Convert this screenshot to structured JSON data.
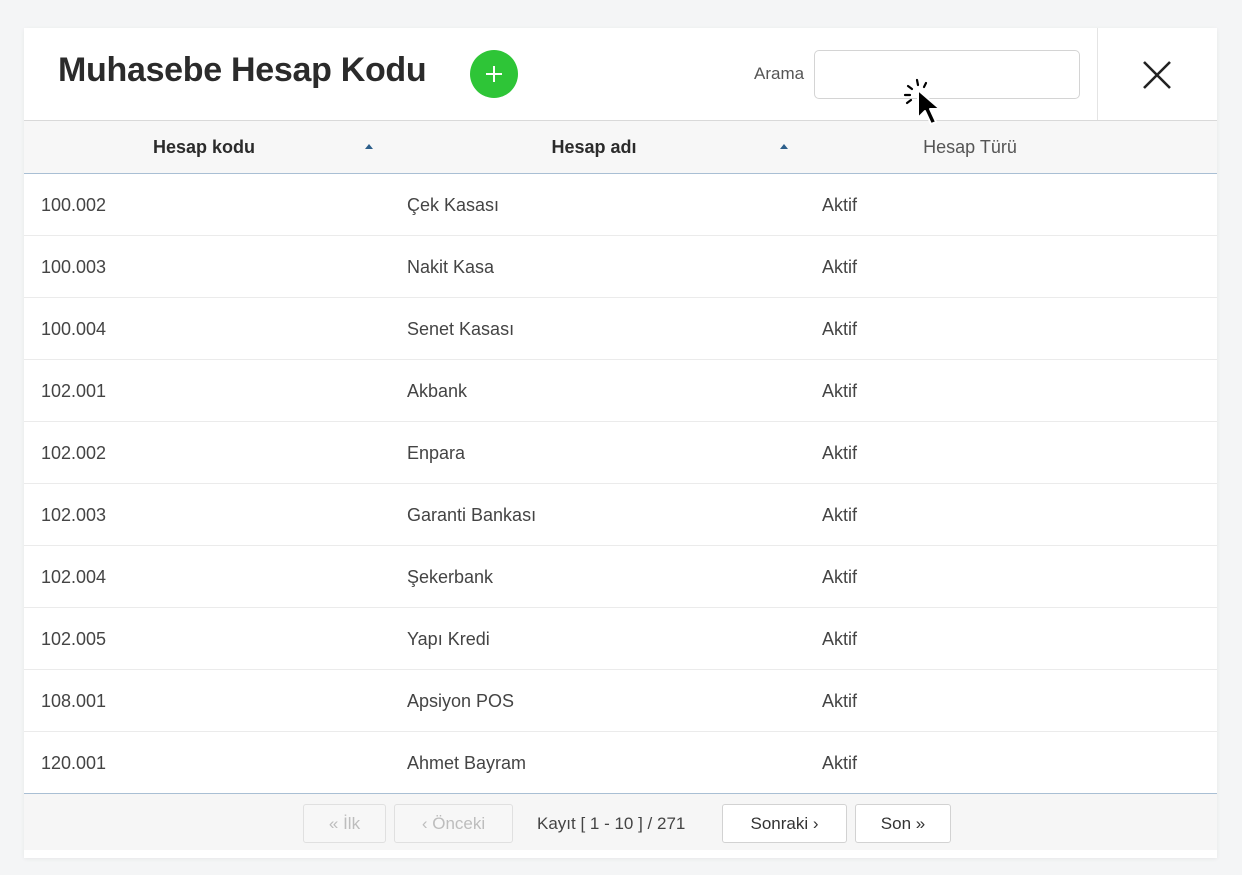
{
  "dialog": {
    "title": "Muhasebe Hesap Kodu",
    "add_label": "+",
    "search": {
      "label": "Arama",
      "value": "",
      "placeholder": ""
    },
    "close_label": "Close"
  },
  "table": {
    "columns": [
      {
        "label": "Hesap kodu",
        "sortable": true,
        "sort": "asc"
      },
      {
        "label": "Hesap adı",
        "sortable": true,
        "sort": "asc"
      },
      {
        "label": "Hesap Türü",
        "sortable": false
      }
    ],
    "rows": [
      {
        "code": "100.002",
        "name": "Çek Kasası",
        "type": "Aktif"
      },
      {
        "code": "100.003",
        "name": "Nakit Kasa",
        "type": "Aktif"
      },
      {
        "code": "100.004",
        "name": "Senet Kasası",
        "type": "Aktif"
      },
      {
        "code": "102.001",
        "name": "Akbank",
        "type": "Aktif"
      },
      {
        "code": "102.002",
        "name": "Enpara",
        "type": "Aktif"
      },
      {
        "code": "102.003",
        "name": "Garanti Bankası",
        "type": "Aktif"
      },
      {
        "code": "102.004",
        "name": "Şekerbank",
        "type": "Aktif"
      },
      {
        "code": "102.005",
        "name": "Yapı Kredi",
        "type": "Aktif"
      },
      {
        "code": "108.001",
        "name": "Apsiyon POS",
        "type": "Aktif"
      },
      {
        "code": "120.001",
        "name": "Ahmet Bayram",
        "type": "Aktif"
      }
    ]
  },
  "pagination": {
    "first_label": "« İlk",
    "prev_label": "‹ Önceki",
    "info": "Kayıt [ 1 - 10 ] / 271",
    "next_label": "Sonraki ›",
    "last_label": "Son »"
  },
  "colors": {
    "add_button": "#2ec537",
    "sort_icon": "#2d5f8b",
    "header_border": "#a9bfd4"
  },
  "icons": {
    "add": "plus-icon",
    "close": "close-icon",
    "sort": "sort-asc-icon",
    "cursor": "mouse-pointer-icon"
  }
}
